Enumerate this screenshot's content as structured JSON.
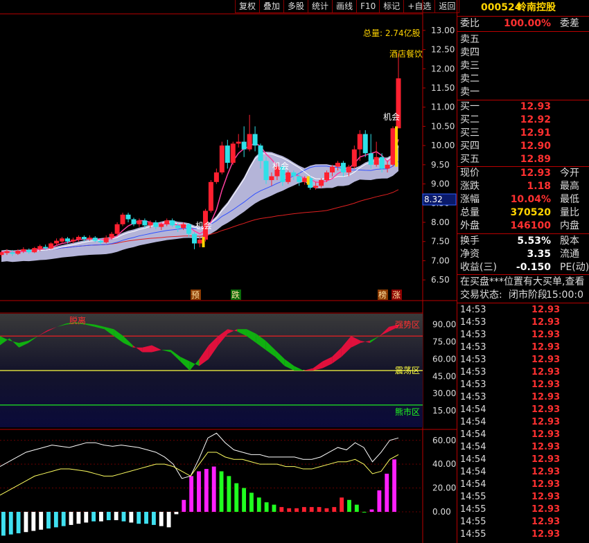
{
  "toolbar": [
    "复权",
    "叠加",
    "多股",
    "统计",
    "画线",
    "F10",
    "标记",
    "+自选",
    "返回"
  ],
  "stock": {
    "code": "000524",
    "name": "岭南控股"
  },
  "quote": {
    "weibi_label": "委比",
    "weibi_value": "100.00%",
    "weicha_label": "委差",
    "sell": [
      "卖五",
      "卖四",
      "卖三",
      "卖二",
      "卖一"
    ],
    "buy": [
      {
        "label": "买一",
        "price": "12.93"
      },
      {
        "label": "买二",
        "price": "12.92"
      },
      {
        "label": "买三",
        "price": "12.91"
      },
      {
        "label": "买四",
        "price": "12.90"
      },
      {
        "label": "买五",
        "price": "12.89"
      }
    ],
    "stats": [
      {
        "label": "现价",
        "value": "12.93",
        "label2": "今开",
        "color": "#ff3030"
      },
      {
        "label": "涨跌",
        "value": "1.18",
        "label2": "最高",
        "color": "#ff3030"
      },
      {
        "label": "涨幅",
        "value": "10.04%",
        "label2": "最低",
        "color": "#ff3030"
      },
      {
        "label": "总量",
        "value": "370520",
        "label2": "量比",
        "color": "#ffd400"
      },
      {
        "label": "外盘",
        "value": "146100",
        "label2": "内盘",
        "color": "#ff3030"
      }
    ],
    "stats2": [
      {
        "label": "换手",
        "value": "5.53%",
        "label2": "股本",
        "color": "#ffffff"
      },
      {
        "label": "净资",
        "value": "3.35",
        "label2": "流通",
        "color": "#ffffff"
      },
      {
        "label": "收益(三)",
        "value": "-0.150",
        "label2": "PE(动)",
        "color": "#ffffff"
      }
    ],
    "notice": "在买盘***位置有大买单,查看",
    "status_label": "交易状态:",
    "status_value": "闭市阶段",
    "status_time": "15:00:0",
    "ticks": [
      [
        "14:53",
        "12.93"
      ],
      [
        "14:53",
        "12.93"
      ],
      [
        "14:53",
        "12.93"
      ],
      [
        "14:53",
        "12.93"
      ],
      [
        "14:53",
        "12.93"
      ],
      [
        "14:53",
        "12.93"
      ],
      [
        "14:53",
        "12.93"
      ],
      [
        "14:53",
        "12.93"
      ],
      [
        "14:54",
        "12.93"
      ],
      [
        "14:54",
        "12.93"
      ],
      [
        "14:54",
        "12.93"
      ],
      [
        "14:54",
        "12.93"
      ],
      [
        "14:54",
        "12.93"
      ],
      [
        "14:54",
        "12.93"
      ],
      [
        "14:54",
        "12.93"
      ],
      [
        "14:55",
        "12.93"
      ],
      [
        "14:55",
        "12.93"
      ],
      [
        "14:55",
        "12.93"
      ],
      [
        "14:55",
        "12.93"
      ]
    ]
  },
  "chart_data": [
    {
      "type": "candlestick",
      "annotations": {
        "total_volume": "总量: 2.74亿股",
        "sector": "酒店餐饮",
        "signal": "机会",
        "current_price_tag": "8.32"
      },
      "y_ticks": [
        "13.00",
        "12.50",
        "12.00",
        "11.50",
        "11.00",
        "10.50",
        "10.00",
        "9.50",
        "9.00",
        "8.50",
        "8.00",
        "7.50",
        "7.00",
        "6.50"
      ],
      "ylim": [
        6.25,
        13.25
      ],
      "bottom_labels": [
        "预",
        "跌",
        "榜",
        "涨"
      ],
      "candles": [
        [
          7.15,
          7.22,
          7.1,
          7.25
        ],
        [
          7.2,
          7.25,
          7.15,
          7.3
        ],
        [
          7.22,
          7.18,
          7.12,
          7.28
        ],
        [
          7.18,
          7.26,
          7.15,
          7.3
        ],
        [
          7.25,
          7.3,
          7.2,
          7.35
        ],
        [
          7.28,
          7.22,
          7.18,
          7.32
        ],
        [
          7.22,
          7.33,
          7.2,
          7.36
        ],
        [
          7.3,
          7.38,
          7.25,
          7.42
        ],
        [
          7.36,
          7.32,
          7.28,
          7.42
        ],
        [
          7.32,
          7.45,
          7.3,
          7.48
        ],
        [
          7.45,
          7.52,
          7.4,
          7.58
        ],
        [
          7.5,
          7.58,
          7.45,
          7.62
        ],
        [
          7.58,
          7.5,
          7.45,
          7.62
        ],
        [
          7.5,
          7.55,
          7.45,
          7.6
        ],
        [
          7.55,
          7.62,
          7.5,
          7.66
        ],
        [
          7.62,
          7.56,
          7.5,
          7.66
        ],
        [
          7.56,
          7.6,
          7.52,
          7.66
        ],
        [
          7.6,
          7.52,
          7.48,
          7.64
        ],
        [
          7.52,
          7.48,
          7.42,
          7.58
        ],
        [
          7.48,
          7.6,
          7.45,
          7.66
        ],
        [
          7.6,
          7.7,
          7.55,
          7.75
        ],
        [
          7.7,
          7.95,
          7.65,
          8.0
        ],
        [
          7.95,
          8.2,
          7.9,
          8.25
        ],
        [
          8.2,
          8.08,
          8.0,
          8.25
        ],
        [
          8.08,
          7.95,
          7.9,
          8.12
        ],
        [
          7.95,
          8.05,
          7.88,
          8.1
        ],
        [
          8.05,
          7.92,
          7.85,
          8.1
        ],
        [
          7.92,
          8.0,
          7.85,
          8.05
        ],
        [
          8.0,
          7.88,
          7.82,
          8.05
        ],
        [
          7.88,
          7.95,
          7.8,
          8.0
        ],
        [
          7.95,
          8.05,
          7.9,
          8.1
        ],
        [
          8.05,
          7.92,
          7.88,
          8.1
        ],
        [
          7.92,
          7.85,
          7.75,
          7.98
        ],
        [
          7.85,
          7.95,
          7.8,
          8.0
        ],
        [
          7.95,
          7.7,
          7.62,
          7.98
        ],
        [
          7.7,
          7.45,
          7.3,
          7.75
        ],
        [
          7.45,
          7.55,
          7.35,
          7.62
        ],
        [
          7.55,
          8.3,
          7.5,
          8.35
        ],
        [
          8.3,
          9.05,
          8.25,
          9.1
        ],
        [
          9.05,
          9.3,
          9.0,
          9.4
        ],
        [
          9.3,
          10.0,
          9.25,
          10.1
        ],
        [
          10.0,
          9.55,
          9.4,
          10.15
        ],
        [
          9.55,
          10.05,
          9.5,
          10.1
        ],
        [
          10.05,
          10.1,
          9.95,
          10.3
        ],
        [
          10.1,
          9.9,
          9.7,
          10.5
        ],
        [
          9.9,
          10.3,
          9.85,
          10.8
        ],
        [
          10.3,
          10.0,
          9.85,
          10.5
        ],
        [
          10.0,
          9.6,
          9.4,
          10.05
        ],
        [
          9.6,
          9.1,
          9.0,
          9.7
        ],
        [
          9.1,
          9.2,
          8.95,
          9.3
        ],
        [
          9.2,
          9.45,
          9.1,
          9.55
        ],
        [
          9.45,
          9.05,
          8.95,
          9.5
        ],
        [
          9.05,
          9.3,
          9.0,
          9.35
        ],
        [
          9.3,
          9.2,
          9.1,
          9.35
        ],
        [
          9.2,
          9.05,
          8.95,
          9.3
        ],
        [
          9.05,
          9.15,
          8.98,
          9.2
        ],
        [
          9.15,
          8.9,
          8.85,
          9.2
        ],
        [
          8.9,
          8.95,
          8.85,
          9.05
        ],
        [
          8.95,
          9.1,
          8.9,
          9.15
        ],
        [
          9.1,
          9.3,
          9.05,
          9.35
        ],
        [
          9.3,
          9.45,
          9.2,
          9.5
        ],
        [
          9.45,
          9.55,
          9.35,
          9.6
        ],
        [
          9.55,
          9.3,
          9.2,
          9.6
        ],
        [
          9.3,
          9.45,
          9.2,
          9.5
        ],
        [
          9.45,
          9.9,
          9.4,
          10.0
        ],
        [
          9.9,
          10.3,
          9.6,
          10.4
        ],
        [
          10.3,
          9.8,
          9.7,
          10.4
        ],
        [
          9.8,
          9.5,
          9.4,
          10.3
        ],
        [
          9.5,
          9.7,
          9.45,
          10.1
        ],
        [
          9.7,
          9.4,
          9.3,
          9.8
        ],
        [
          9.4,
          9.5,
          9.3,
          9.6
        ],
        [
          9.5,
          10.45,
          9.45,
          10.5
        ],
        [
          10.45,
          11.75,
          10.45,
          12.4
        ]
      ]
    },
    {
      "type": "area",
      "y_ticks": [
        "90.00",
        "75.00",
        "60.00",
        "45.00",
        "30.00",
        "15.00"
      ],
      "ylim": [
        0,
        100
      ],
      "zone_labels": [
        "强势区",
        "震荡区",
        "熊市区"
      ],
      "text_label": "脱离",
      "levels": [
        80,
        50,
        20
      ],
      "fast": [
        72,
        78,
        70,
        74,
        80,
        85,
        88,
        90,
        91,
        90,
        88,
        86,
        80,
        74,
        70,
        70,
        72,
        68,
        66,
        58,
        50,
        60,
        72,
        80,
        86,
        84,
        80,
        74,
        68,
        62,
        54,
        50,
        50,
        52,
        58,
        62,
        70,
        80,
        76,
        74,
        80,
        88,
        90
      ],
      "slow": [
        80,
        76,
        74,
        76,
        80,
        84,
        88,
        91,
        92,
        91,
        90,
        88,
        86,
        80,
        72,
        66,
        66,
        68,
        68,
        62,
        58,
        54,
        60,
        72,
        82,
        86,
        86,
        82,
        76,
        68,
        60,
        54,
        50,
        50,
        52,
        56,
        62,
        70,
        74,
        76,
        80,
        84,
        88
      ]
    },
    {
      "type": "bar",
      "y_ticks": [
        "60.00",
        "40.00",
        "20.00",
        "0.00"
      ],
      "ylim": [
        -25,
        68
      ],
      "values": [
        -20,
        -19,
        -18,
        -17,
        -16,
        -15,
        -14,
        -13,
        -12,
        -11,
        -10,
        -9,
        -8,
        -8,
        -7,
        -7,
        -8,
        -9,
        -10,
        -10,
        -11,
        -12,
        -13,
        -2,
        10,
        30,
        34,
        36,
        38,
        34,
        30,
        24,
        20,
        16,
        12,
        8,
        6,
        4,
        3,
        3,
        4,
        4,
        4,
        3,
        4,
        12,
        10,
        6,
        0,
        2,
        18,
        32,
        44
      ],
      "line1": [
        38,
        42,
        46,
        50,
        52,
        54,
        56,
        55,
        54,
        56,
        58,
        58,
        56,
        55,
        56,
        55,
        54,
        52,
        50,
        46,
        40,
        28,
        30,
        45,
        62,
        66,
        58,
        52,
        50,
        48,
        48,
        46,
        46,
        46,
        46,
        44,
        44,
        46,
        50,
        54,
        52,
        58,
        54,
        42,
        50,
        60,
        62
      ],
      "line2": [
        14,
        18,
        22,
        26,
        30,
        32,
        34,
        36,
        36,
        35,
        34,
        32,
        30,
        30,
        32,
        34,
        36,
        38,
        40,
        40,
        38,
        34,
        30,
        40,
        50,
        50,
        46,
        44,
        44,
        42,
        40,
        40,
        40,
        38,
        38,
        36,
        36,
        38,
        40,
        42,
        42,
        44,
        40,
        32,
        34,
        44,
        48
      ]
    }
  ]
}
